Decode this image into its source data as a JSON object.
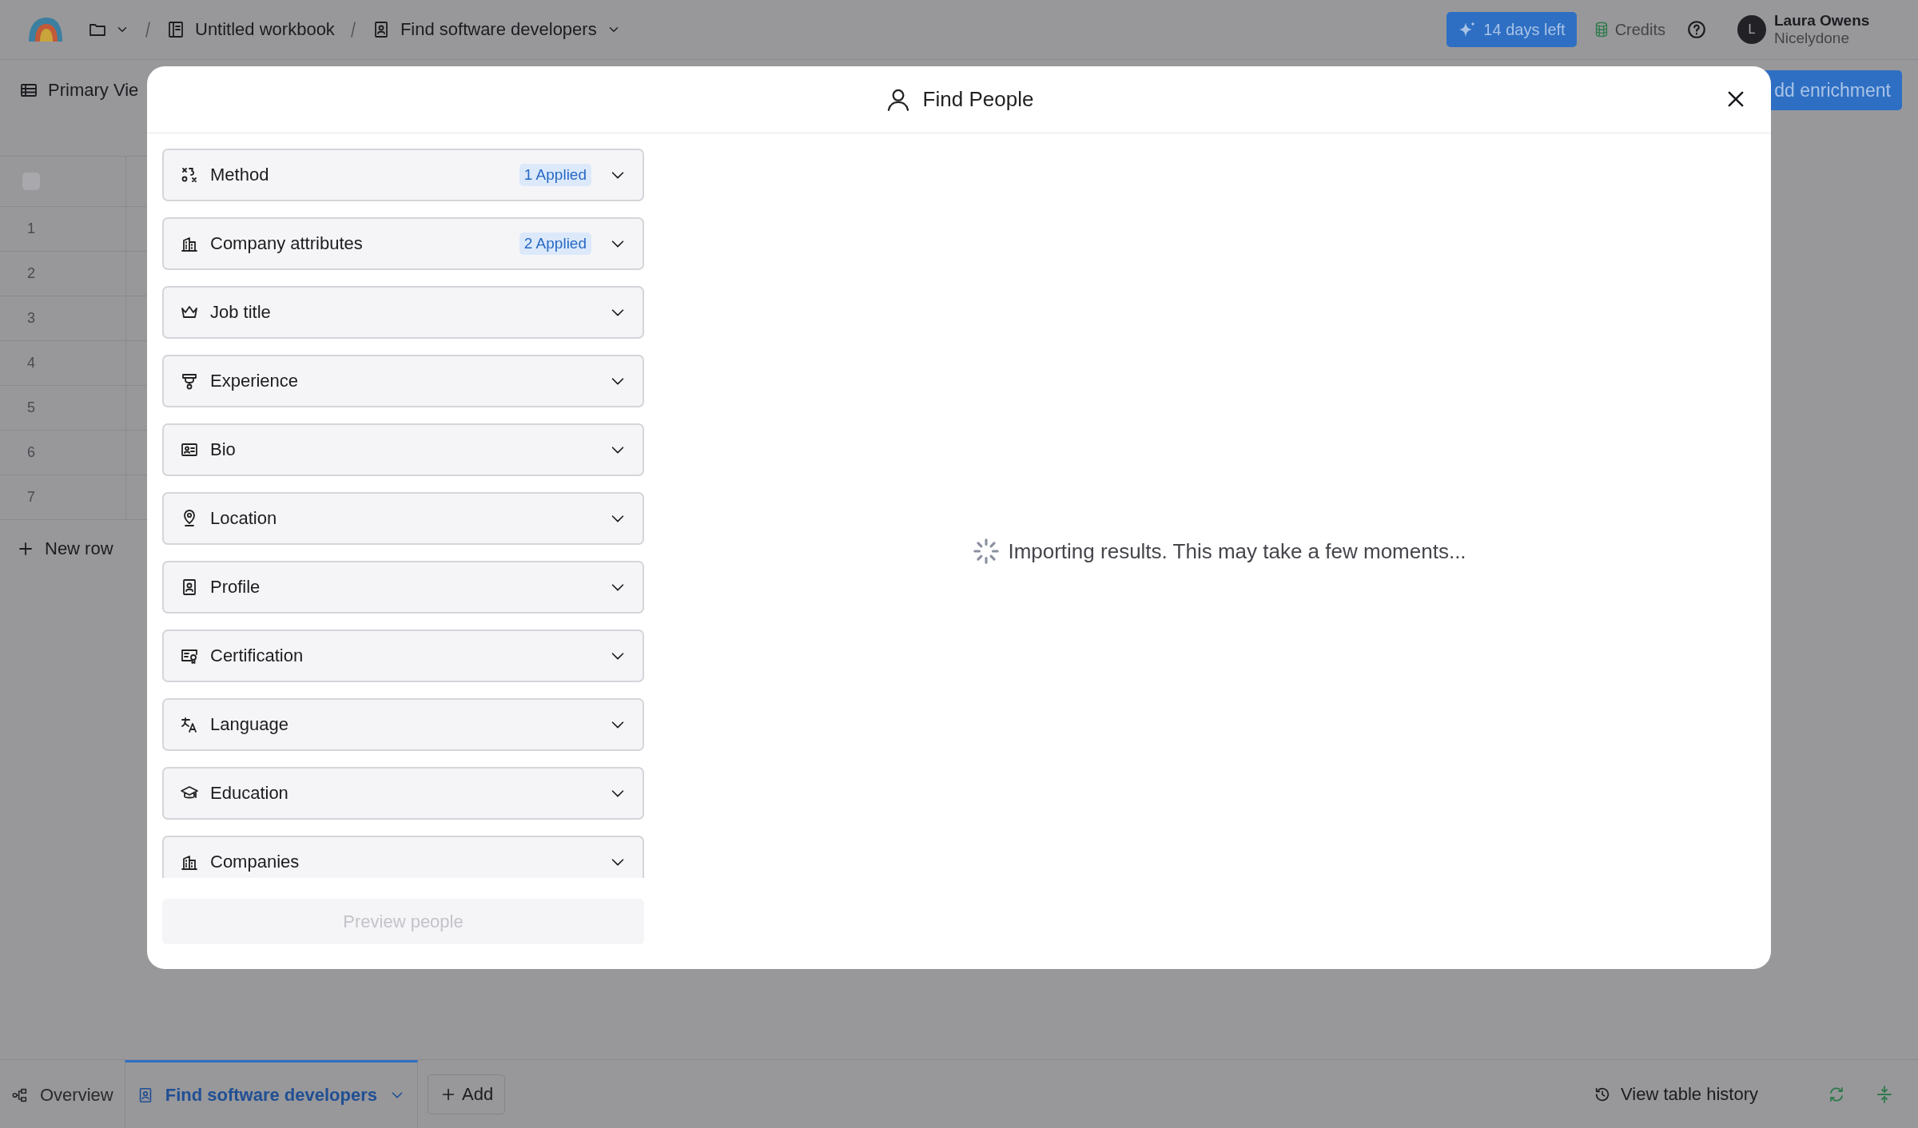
{
  "top_bar": {
    "breadcrumbs": [
      {
        "label": "Untitled workbook",
        "kind": "workbook"
      },
      {
        "label": "Find software developers",
        "kind": "table"
      }
    ],
    "trial_button": "14 days left",
    "credits": "Credits",
    "user": {
      "initial": "L",
      "name": "Laura Owens",
      "org": "Nicelydone"
    }
  },
  "view_bar": {
    "view": "Primary Vie",
    "action": "dd enrichment"
  },
  "table": {
    "select_all": {
      "checked": false
    },
    "rows": [
      "1",
      "2",
      "3",
      "4",
      "5",
      "6",
      "7"
    ],
    "new_row": "New row"
  },
  "modal": {
    "title": "Find People",
    "filters": [
      {
        "label": "Method",
        "kind": "method",
        "applied": "1 Applied"
      },
      {
        "label": "Company attributes",
        "kind": "building",
        "applied": "2 Applied"
      },
      {
        "label": "Job title",
        "kind": "crown"
      },
      {
        "label": "Experience",
        "kind": "trophy"
      },
      {
        "label": "Bio",
        "kind": "idcard"
      },
      {
        "label": "Location",
        "kind": "pin"
      },
      {
        "label": "Profile",
        "kind": "badge"
      },
      {
        "label": "Certification",
        "kind": "certificate"
      },
      {
        "label": "Language",
        "kind": "language"
      },
      {
        "label": "Education",
        "kind": "cap"
      },
      {
        "label": "Companies",
        "kind": "building"
      }
    ],
    "status": "Importing results. This may take a few moments...",
    "preview_button": {
      "label": "Preview people",
      "disabled": true
    }
  },
  "bottom_bar": {
    "tabs": [
      {
        "label": "Overview",
        "kind": "overview",
        "selected": false
      },
      {
        "label": "Find software developers",
        "kind": "table",
        "selected": true
      }
    ],
    "add_button": "Add",
    "history_button": "View table history"
  }
}
